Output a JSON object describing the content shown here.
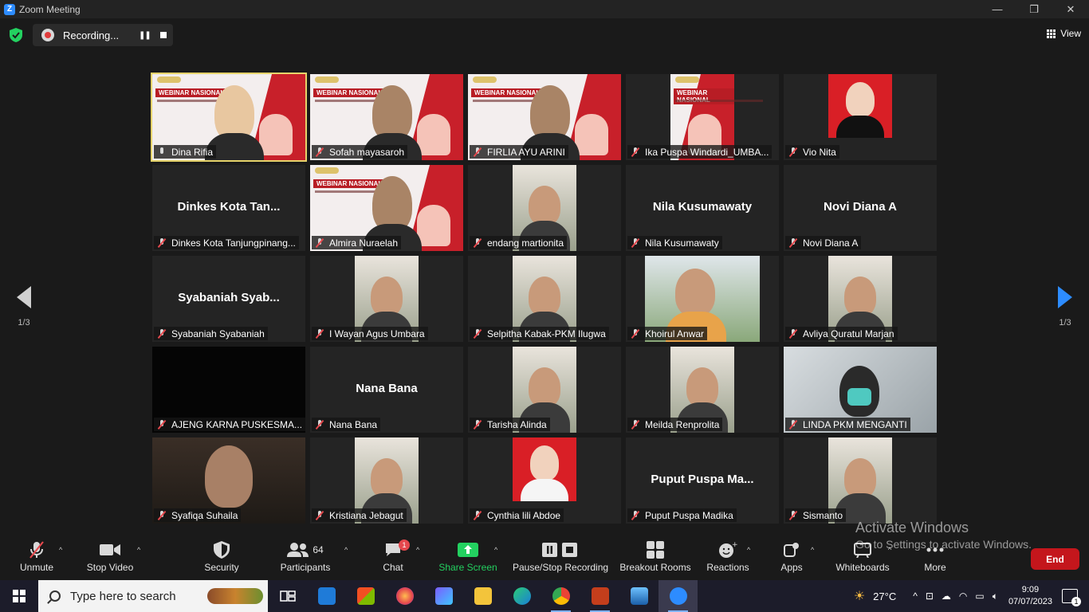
{
  "window": {
    "title": "Zoom Meeting",
    "controls": [
      "—",
      "❐",
      "✕"
    ]
  },
  "topbar": {
    "recording_label": "Recording...",
    "view_label": "View"
  },
  "pager": {
    "left": "1/3",
    "right": "1/3"
  },
  "participants": [
    {
      "name": "Dina Rifia",
      "big": "",
      "video": "webinar",
      "active": true,
      "mic": "on"
    },
    {
      "name": "Sofah mayasaroh",
      "big": "",
      "video": "webinar",
      "mic": "off"
    },
    {
      "name": "FIRLIA AYU ARINI",
      "big": "",
      "video": "webinar",
      "mic": "off"
    },
    {
      "name": "Ika Puspa Windardi_UMBA...",
      "big": "",
      "video": "webinar-narrow",
      "mic": "off"
    },
    {
      "name": "Vio Nita",
      "big": "",
      "video": "redphoto",
      "mic": "off"
    },
    {
      "name": "Dinkes Kota Tanjungpinang...",
      "big": "Dinkes Kota Tan...",
      "video": "none",
      "mic": "off"
    },
    {
      "name": "Almira Nuraelah",
      "big": "",
      "video": "webinar",
      "mic": "off"
    },
    {
      "name": "endang martionita",
      "big": "",
      "video": "narrow",
      "mic": "off"
    },
    {
      "name": "Nila Kusumawaty",
      "big": "Nila Kusumawaty",
      "video": "none",
      "mic": "off"
    },
    {
      "name": "Novi Diana A",
      "big": "Novi Diana A",
      "video": "none",
      "mic": "off"
    },
    {
      "name": "Syabaniah Syabaniah",
      "big": "Syabaniah  Syab...",
      "video": "none",
      "mic": "off"
    },
    {
      "name": "I Wayan Agus Umbara",
      "big": "",
      "video": "narrow",
      "mic": "off"
    },
    {
      "name": "Selpitha Kabak-PKM Ilugwa",
      "big": "",
      "video": "narrow",
      "mic": "off"
    },
    {
      "name": "Khoirul Anwar",
      "big": "",
      "video": "wide",
      "mic": "off"
    },
    {
      "name": "Avliya Quratul Marjan",
      "big": "",
      "video": "narrow",
      "mic": "off"
    },
    {
      "name": "AJENG KARNA PUSKESMA...",
      "big": "",
      "video": "black",
      "mic": "off"
    },
    {
      "name": "Nana Bana",
      "big": "Nana Bana",
      "video": "none",
      "mic": "off"
    },
    {
      "name": "Tarisha Alinda",
      "big": "",
      "video": "narrow",
      "mic": "off"
    },
    {
      "name": "Meilda Renprolita",
      "big": "",
      "video": "narrow",
      "mic": "off"
    },
    {
      "name": "LINDA PKM MENGANTI",
      "big": "",
      "video": "full",
      "mic": "off"
    },
    {
      "name": "Syafiqa Suhaila",
      "big": "",
      "video": "full-dark",
      "mic": "off"
    },
    {
      "name": "Kristiana Jebagut",
      "big": "",
      "video": "narrow",
      "mic": "off"
    },
    {
      "name": "Cynthia lili Abdoe",
      "big": "",
      "video": "redphoto",
      "mic": "off"
    },
    {
      "name": "Puput Puspa Madika",
      "big": "Puput  Puspa  Ma...",
      "video": "none",
      "mic": "off"
    },
    {
      "name": "Sismanto",
      "big": "",
      "video": "narrow",
      "mic": "off"
    }
  ],
  "webinar_slide": {
    "title": "WEBINAR NASIONAL"
  },
  "toolbar": {
    "unmute": "Unmute",
    "stop_video": "Stop Video",
    "security": "Security",
    "participants": "Participants",
    "participants_count": "64",
    "chat": "Chat",
    "chat_badge": "1",
    "share_screen": "Share Screen",
    "pause_stop_recording": "Pause/Stop Recording",
    "breakout_rooms": "Breakout Rooms",
    "reactions": "Reactions",
    "apps": "Apps",
    "whiteboards": "Whiteboards",
    "more": "More",
    "end": "End"
  },
  "watermark": {
    "line1": "Activate Windows",
    "line2": "Go to Settings to activate Windows."
  },
  "taskbar": {
    "search_placeholder": "Type here to search",
    "weather": "27°C",
    "time": "9:09",
    "date": "07/07/2023",
    "notification_count": "1"
  },
  "colors": {
    "accent": "#2d8cff",
    "end": "#c4161c",
    "share": "#23d160",
    "active_speaker": "#e6d36a"
  }
}
